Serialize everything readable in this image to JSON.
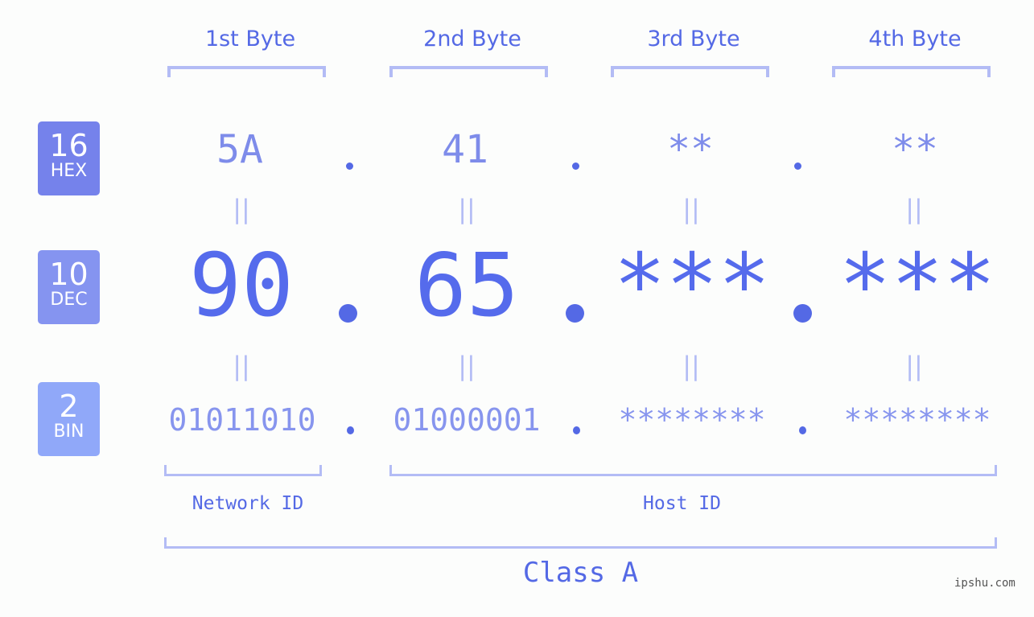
{
  "bytes": [
    {
      "label": "1st Byte",
      "hex": "5A",
      "dec": "90",
      "bin": "01011010"
    },
    {
      "label": "2nd Byte",
      "hex": "41",
      "dec": "65",
      "bin": "01000001"
    },
    {
      "label": "3rd Byte",
      "hex": "**",
      "dec": "***",
      "bin": "********"
    },
    {
      "label": "4th Byte",
      "hex": "**",
      "dec": "***",
      "bin": "********"
    }
  ],
  "badges": {
    "hex": {
      "num": "16",
      "label": "HEX",
      "color": "#7582eb"
    },
    "dec": {
      "num": "10",
      "label": "DEC",
      "color": "#8594f0"
    },
    "bin": {
      "num": "2",
      "label": "BIN",
      "color": "#90a8f9"
    }
  },
  "equals_symbol": "||",
  "network_id_label": "Network ID",
  "host_id_label": "Host ID",
  "class_label": "Class A",
  "watermark": "ipshu.com",
  "colors": {
    "accent": "#5469e5",
    "bracket": "#b3bcf5"
  }
}
